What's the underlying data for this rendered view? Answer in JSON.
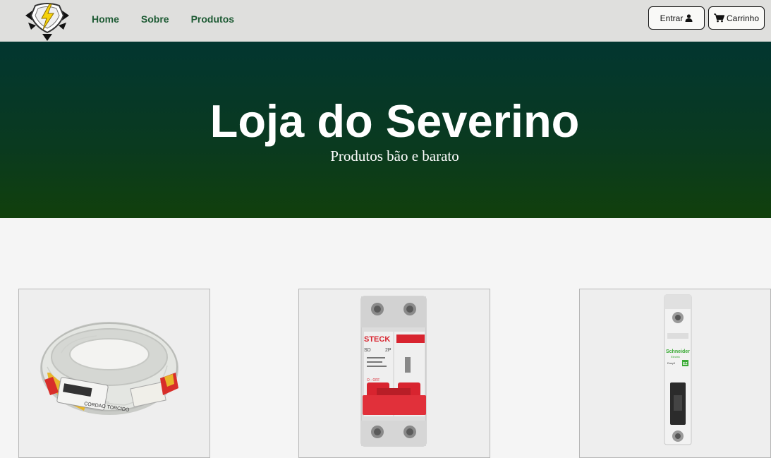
{
  "nav": {
    "links": [
      "Home",
      "Sobre",
      "Produtos"
    ],
    "login_label": "Entrar",
    "cart_label": "Carrinho"
  },
  "hero": {
    "title": "Loja do Severino",
    "subtitle": "Produtos bão e barato"
  },
  "products": [
    {
      "name": "cordao-torcido-cable-roll",
      "label_text": "CORDAO TORCIDO"
    },
    {
      "name": "steck-breaker-2p",
      "brand_text": "STECK",
      "model_text": "SD",
      "poles_text": "2P",
      "off_text": "O - OFF"
    },
    {
      "name": "schneider-breaker-1p",
      "brand_text": "Schneider",
      "sub_text": "Electric",
      "series_text": "Easy9",
      "badge_text": "EZ"
    }
  ],
  "colors": {
    "nav_bg": "#dfdfdd",
    "nav_link": "#1e5b34",
    "hero_top": "#023630",
    "hero_bottom": "#11400c",
    "page_bg": "#f5f5f5",
    "steck_red": "#d8242f"
  },
  "icons": {
    "login": "user-icon",
    "cart": "cart-icon",
    "logo": "lightning-arrows-logo"
  }
}
